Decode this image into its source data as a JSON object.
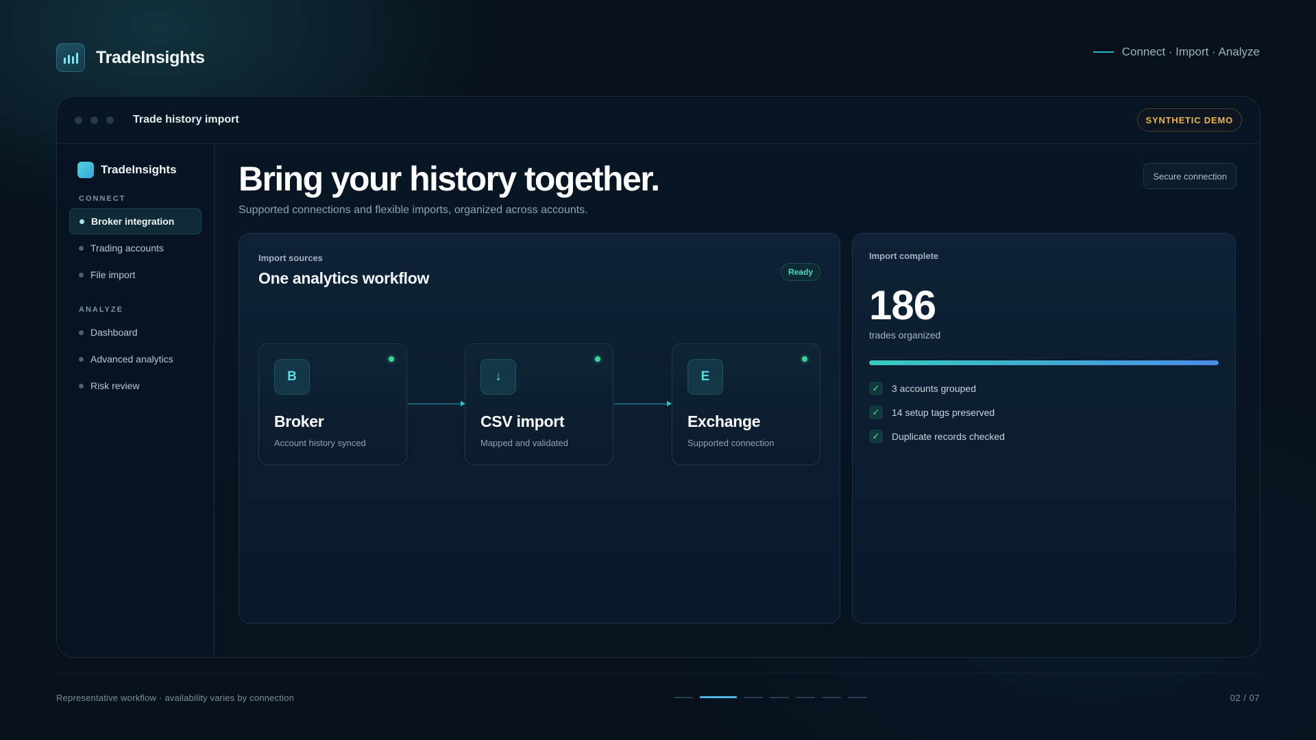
{
  "header": {
    "brand_name": "TradeInsights",
    "brand_icon": "bar-chart-icon",
    "tagline": "Connect · Import · Analyze"
  },
  "window": {
    "title": "Trade history import",
    "badge": "SYNTHETIC DEMO"
  },
  "sidebar": {
    "brand_name": "TradeInsights",
    "sections": [
      {
        "label": "CONNECT",
        "items": [
          {
            "label": "Broker integration",
            "active": true
          },
          {
            "label": "Trading accounts",
            "active": false
          },
          {
            "label": "File import",
            "active": false
          }
        ]
      },
      {
        "label": "ANALYZE",
        "items": [
          {
            "label": "Dashboard",
            "active": false
          },
          {
            "label": "Advanced analytics",
            "active": false
          },
          {
            "label": "Risk review",
            "active": false
          }
        ]
      }
    ]
  },
  "main": {
    "headline": "Bring your history together.",
    "subhead": "Supported connections and flexible imports, organized across accounts.",
    "secure_button": "Secure connection",
    "sources": {
      "label": "Import sources",
      "title": "One analytics workflow",
      "status": "Ready",
      "nodes": [
        {
          "glyph": "B",
          "icon": "broker-icon",
          "title": "Broker",
          "subtitle": "Account history synced"
        },
        {
          "glyph": "↓",
          "icon": "download-icon",
          "title": "CSV import",
          "subtitle": "Mapped and validated"
        },
        {
          "glyph": "E",
          "icon": "exchange-icon",
          "title": "Exchange",
          "subtitle": "Supported connection"
        }
      ]
    },
    "complete": {
      "label": "Import complete",
      "count": "186",
      "count_caption": "trades organized",
      "progress": 1.0,
      "checks": [
        "3 accounts grouped",
        "14 setup tags preserved",
        "Duplicate records checked"
      ]
    }
  },
  "footer": {
    "note": "Representative workflow · availability varies by connection",
    "page_indicator": "02 / 07",
    "pager_total": 7,
    "pager_active": 2
  },
  "colors": {
    "background": "#06111c",
    "accent": "#2fc2cf",
    "badge": "#f0b452",
    "status": "#3fd49a"
  }
}
